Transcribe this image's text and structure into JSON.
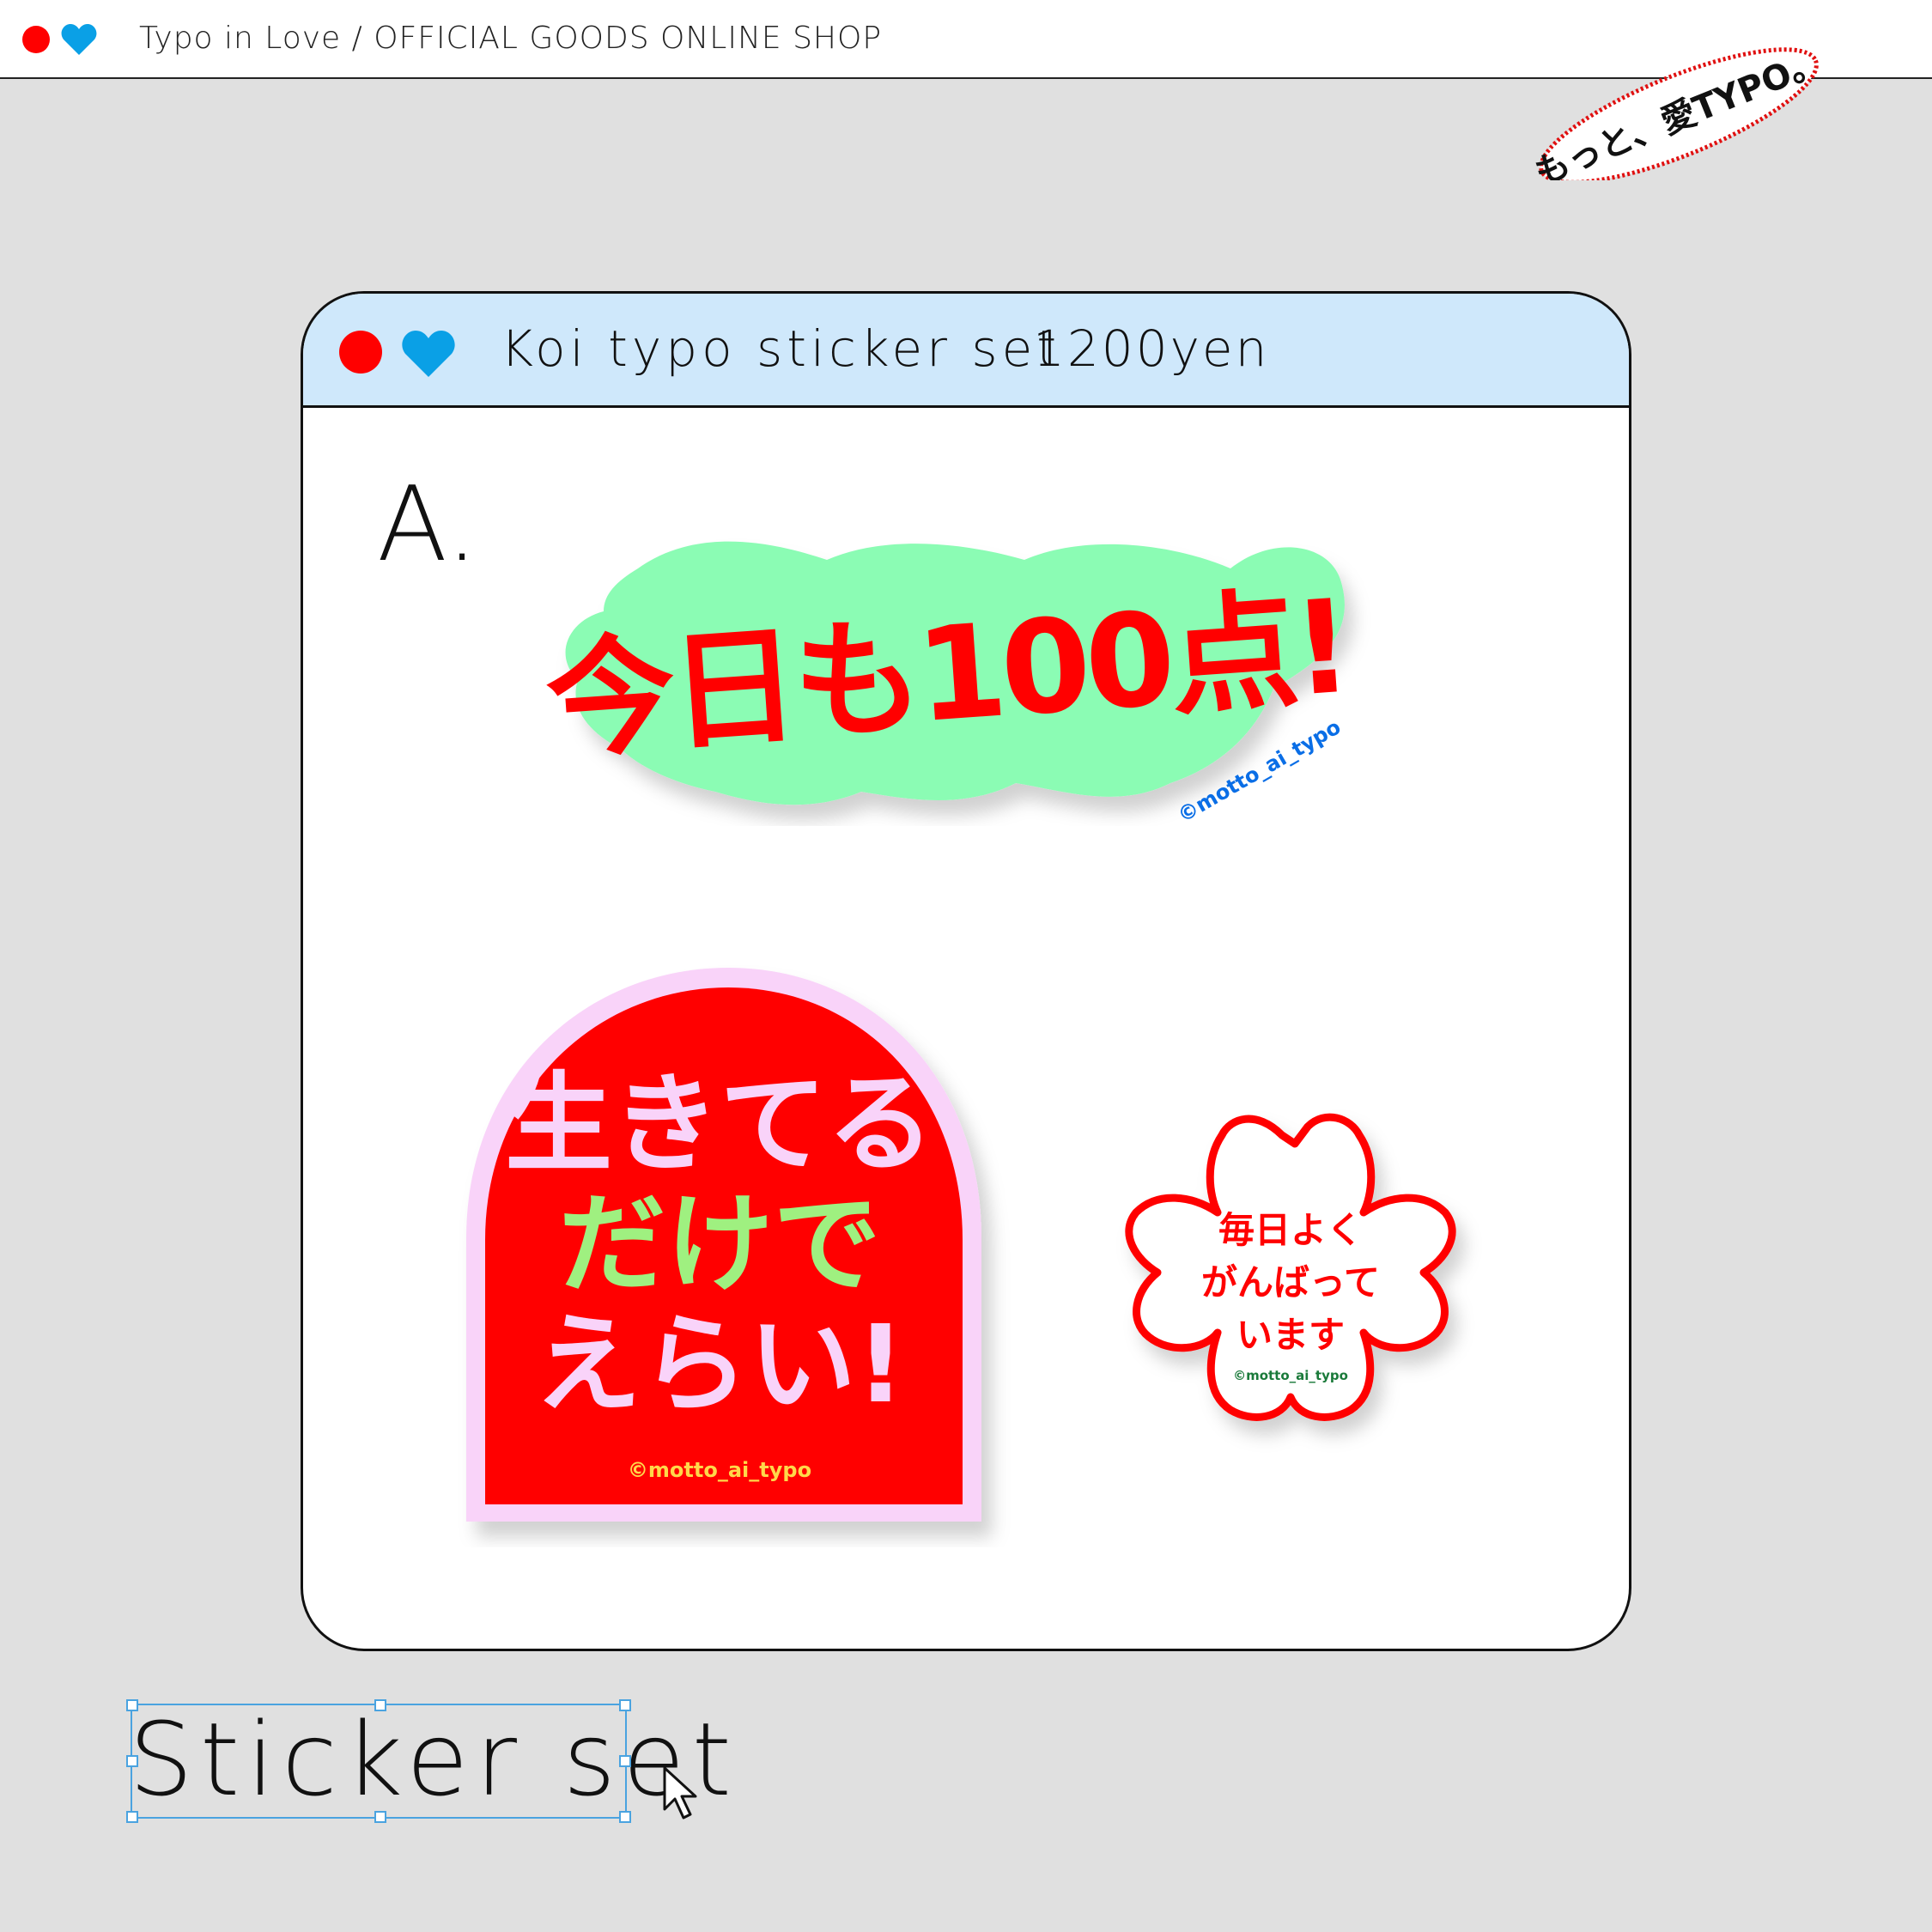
{
  "header": {
    "title": "Typo in Love / OFFICIAL GOODS ONLINE SHOP",
    "dot_icon": "red-circle",
    "heart_icon": "blue-heart"
  },
  "badge": {
    "text": "もっと、愛TYPO。"
  },
  "product": {
    "name": "Koi typo sticker set",
    "price": "1200yen",
    "variant": "A.",
    "stickers": [
      {
        "id": "sticker-100",
        "text": "今日も100点!",
        "credit": "©motto_ai_typo"
      },
      {
        "id": "sticker-erai",
        "lines": [
          "生きてる",
          "だけで",
          "えらい!"
        ],
        "credit": "©motto_ai_typo"
      },
      {
        "id": "sticker-sakura",
        "lines": [
          "毎日よく",
          "がんばって",
          "います"
        ],
        "credit": "©motto_ai_typo"
      }
    ]
  },
  "caption": {
    "text": "Sticker set"
  },
  "colors": {
    "red": "#ff0000",
    "blue": "#0aa0e6",
    "mint": "#8bfcb4",
    "pink": "#f9d3f9",
    "green": "#9ff080",
    "titlebar": "#cfe8fb",
    "background": "#e0e0e0"
  }
}
